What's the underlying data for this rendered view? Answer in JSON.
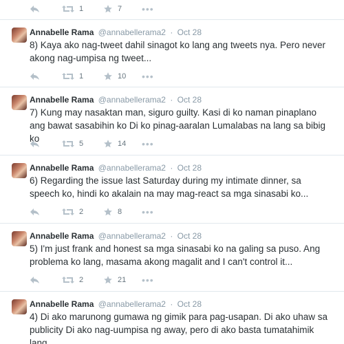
{
  "top_actions": {
    "retweets": "1",
    "favorites": "7"
  },
  "tweets": [
    {
      "name": "Annabelle Rama",
      "handle": "@annabellerama2",
      "separator": "·",
      "time": "Oct 28",
      "text": "8) Kaya ako nag-tweet dahil sinagot ko lang ang tweets nya. Pero never akong nag-umpisa ng tweet...",
      "retweets": "1",
      "favorites": "10"
    },
    {
      "name": "Annabelle Rama",
      "handle": "@annabellerama2",
      "separator": "·",
      "time": "Oct 28",
      "text": "7) Kung may nasaktan man, siguro guilty. Kasi di ko naman pinaplano ang bawat sasabihin ko Di ko pinag-aaralan Lumalabas na lang sa bibig ko",
      "retweets": "5",
      "favorites": "14"
    },
    {
      "name": "Annabelle Rama",
      "handle": "@annabellerama2",
      "separator": "·",
      "time": "Oct 28",
      "text": "6) Regarding the issue last Saturday during my intimate dinner, sa speech ko, hindi ko akalain na may mag-react sa mga sinasabi ko...",
      "retweets": "2",
      "favorites": "8"
    },
    {
      "name": "Annabelle Rama",
      "handle": "@annabellerama2",
      "separator": "·",
      "time": "Oct 28",
      "text": "5) I'm just frank and honest sa mga sinasabi ko na galing sa puso. Ang problema ko lang, masama akong magalit and I can't control it...",
      "retweets": "2",
      "favorites": "21"
    },
    {
      "name": "Annabelle Rama",
      "handle": "@annabellerama2",
      "separator": "·",
      "time": "Oct 28",
      "text": "4) Di ako marunong gumawa ng gimik para pag-usapan. Di  ako uhaw sa publicity Di ako nag-uumpisa ng away, pero di ako basta tumatahimik lang"
    }
  ]
}
